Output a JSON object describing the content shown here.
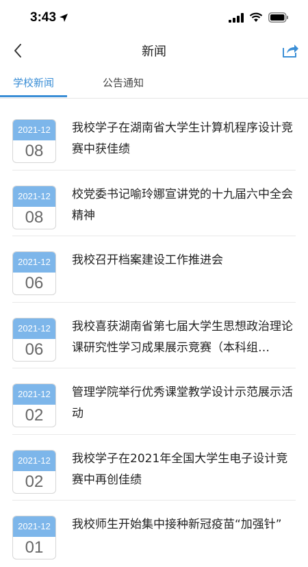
{
  "status": {
    "time": "3:43"
  },
  "nav": {
    "title": "新闻"
  },
  "tabs": [
    {
      "label": "学校新闻",
      "active": true
    },
    {
      "label": "公告通知",
      "active": false
    }
  ],
  "news": [
    {
      "ym": "2021-12",
      "day": "08",
      "title": "我校学子在湖南省大学生计算机程序设计竞赛中获佳绩"
    },
    {
      "ym": "2021-12",
      "day": "08",
      "title": "校党委书记喻玲娜宣讲党的十九届六中全会精神"
    },
    {
      "ym": "2021-12",
      "day": "06",
      "title": "我校召开档案建设工作推进会"
    },
    {
      "ym": "2021-12",
      "day": "06",
      "title": "我校喜获湖南省第七届大学生思想政治理论课研究性学习成果展示竞赛（本科组…"
    },
    {
      "ym": "2021-12",
      "day": "02",
      "title": "管理学院举行优秀课堂教学设计示范展示活动"
    },
    {
      "ym": "2021-12",
      "day": "02",
      "title": "我校学子在2021年全国大学生电子设计竞赛中再创佳绩"
    },
    {
      "ym": "2021-12",
      "day": "01",
      "title": "我校师生开始集中接种新冠疫苗“加强针”"
    }
  ],
  "colors": {
    "accent": "#3a8ed6",
    "badge": "#7db6ea"
  }
}
